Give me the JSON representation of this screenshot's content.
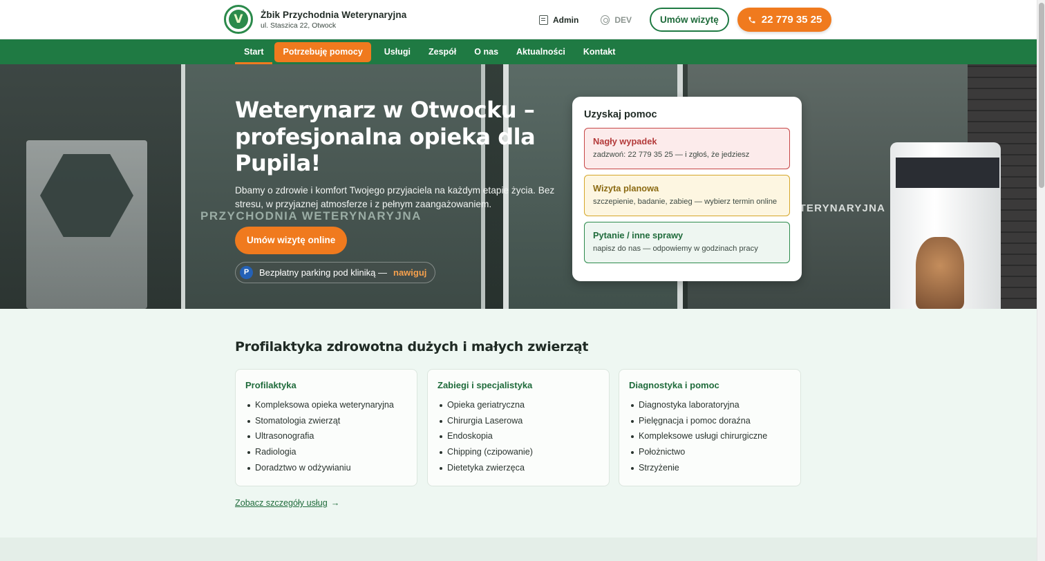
{
  "brand": {
    "name": "Żbik Przychodnia Weterynaryjna",
    "address": "ul. Staszica 22, Otwock"
  },
  "header": {
    "admin_label": "Admin",
    "dev_label": "DEV",
    "book_label": "Umów wizytę",
    "phone_label": "22 779 35 25"
  },
  "nav": {
    "items": [
      {
        "label": "Start"
      },
      {
        "label": "Potrzebuję pomocy"
      },
      {
        "label": "Usługi"
      },
      {
        "label": "Zespół"
      },
      {
        "label": "O nas"
      },
      {
        "label": "Aktualności"
      },
      {
        "label": "Kontakt"
      }
    ]
  },
  "hero": {
    "title": "Weterynarz w Otwocku – profesjonalna opieka dla Pupila!",
    "subtitle": "Dbamy o zdrowie i komfort Twojego przyjaciela na każdym etapie życia. Bez stresu, w przyjaznej atmosferze i z pełnym zaangażowaniem.",
    "cta_label": "Umów wizytę online",
    "parking_badge": "P",
    "parking_text": "Bezpłatny parking pod kliniką —",
    "parking_link": "nawiguj",
    "photo_sign_left": "PRZYCHODNIA WETERYNARYJNA",
    "photo_sign_right": "WETERYNARYJNA"
  },
  "help": {
    "title": "Uzyskaj pomoc",
    "options": [
      {
        "title": "Nagły wypadek",
        "desc": "zadzwoń: 22 779 35 25 — i zgłoś, że jedziesz"
      },
      {
        "title": "Wizyta planowa",
        "desc": "szczepienie, badanie, zabieg — wybierz termin online"
      },
      {
        "title": "Pytanie / inne sprawy",
        "desc": "napisz do nas — odpowiemy w godzinach pracy"
      }
    ]
  },
  "services": {
    "title": "Profilaktyka zdrowotna dużych i małych zwierząt",
    "columns": [
      {
        "title": "Profilaktyka",
        "items": [
          "Kompleksowa opieka weterynaryjna",
          "Stomatologia zwierząt",
          "Ultrasonografia",
          "Radiologia",
          "Doradztwo w odżywianiu"
        ]
      },
      {
        "title": "Zabiegi i specjalistyka",
        "items": [
          "Opieka geriatryczna",
          "Chirurgia Laserowa",
          "Endoskopia",
          "Chipping (czipowanie)",
          "Dietetyka zwierzęca"
        ]
      },
      {
        "title": "Diagnostyka i pomoc",
        "items": [
          "Diagnostyka laboratoryjna",
          "Pielęgnacja i pomoc doraźna",
          "Kompleksowe usługi chirurgiczne",
          "Położnictwo",
          "Strzyżenie"
        ]
      }
    ],
    "more_label": "Zobacz szczegóły usług",
    "more_arrow": "→"
  },
  "colors": {
    "brand_green": "#1f7a43",
    "accent_orange": "#f07a1e",
    "emergency_red": "#c64545",
    "planned_yellow": "#d5a628"
  },
  "icons": {
    "admin": "document-icon",
    "dev": "gear-icon",
    "phone": "phone-icon"
  }
}
